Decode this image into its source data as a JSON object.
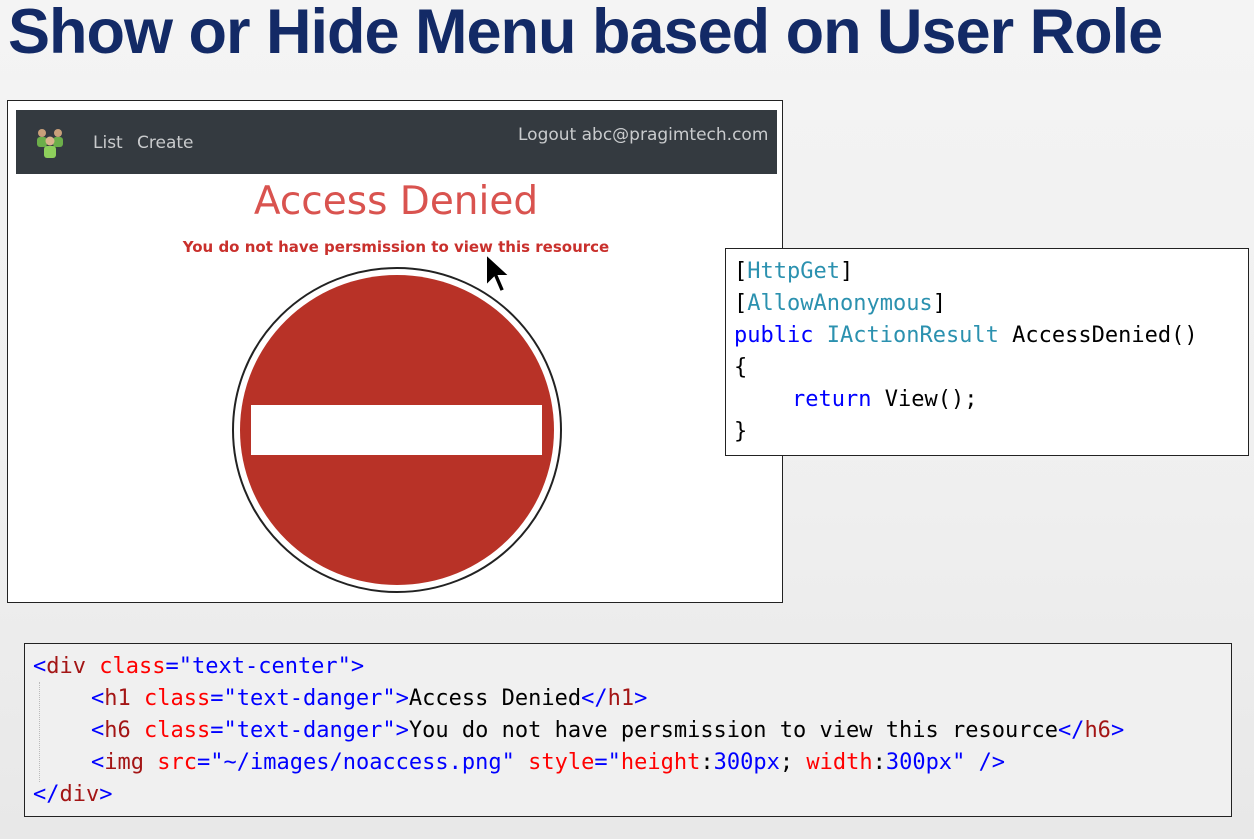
{
  "slide": {
    "title": "Show or Hide Menu based on User Role"
  },
  "browser": {
    "nav": {
      "logo_icon": "users-logo-icon",
      "list_label": "List",
      "create_label": "Create",
      "logout_label": "Logout abc@pragimtech.com"
    },
    "content": {
      "heading": "Access Denied",
      "message": "You do not have persmission to view this resource",
      "image_icon": "no-entry-sign-icon"
    }
  },
  "action_code": {
    "attr1_open": "[",
    "attr1": "HttpGet",
    "attr1_close": "]",
    "attr2_open": "[",
    "attr2": "AllowAnonymous",
    "attr2_close": "]",
    "sig_public": "public",
    "sig_type": "IActionResult",
    "sig_name": " AccessDenied()",
    "open_brace": "{",
    "ret_kw": "return",
    "ret_expr": " View();",
    "close_brace": "}"
  },
  "view_code": {
    "line1": {
      "open": "<",
      "tag": "div",
      "attr": "class",
      "eq": "=",
      "val": "\"text-center\"",
      "close": ">"
    },
    "line2": {
      "open": "<",
      "tag": "h1",
      "attr": "class",
      "eq": "=",
      "val": "\"text-danger\"",
      "close": ">",
      "text": "Access Denied",
      "end_open": "</",
      "end_tag": "h1",
      "end_close": ">"
    },
    "line3": {
      "open": "<",
      "tag": "h6",
      "attr": "class",
      "eq": "=",
      "val": "\"text-danger\"",
      "close": ">",
      "text": "You do not have persmission to view this resource",
      "end_open": "</",
      "end_tag": "h6",
      "end_close": ">"
    },
    "line4": {
      "open": "<",
      "tag": "img",
      "attr1": "src",
      "eq1": "=",
      "val1": "\"~/images/noaccess.png\"",
      "attr2": "style",
      "eq2": "=",
      "q_open": "\"",
      "p1": "height",
      "c1": ":",
      "v1": "300px",
      "sep": ";",
      "p2": "width",
      "c2": ":",
      "v2": "300px",
      "q_close": "\"",
      "selfclose": "/>"
    },
    "line5": {
      "open": "</",
      "tag": "div",
      "close": ">"
    }
  },
  "colors": {
    "title": "#132a66",
    "navbar": "#343a40",
    "danger": "#d9534f",
    "sign_red": "#b83227"
  }
}
